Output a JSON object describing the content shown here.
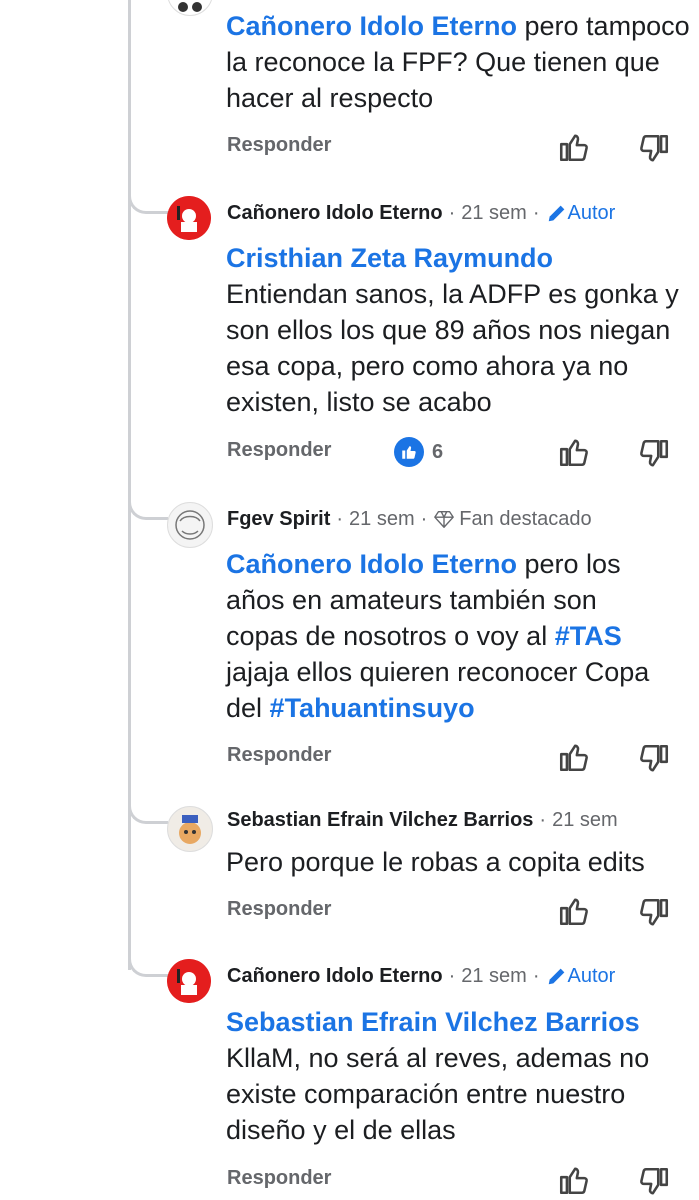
{
  "colors": {
    "accent": "#1b74e4",
    "muted": "#65676b",
    "line": "#ced0d4"
  },
  "comments": [
    {
      "mention": "Cañonero Idolo Eterno",
      "text": " pero tampoco la reconoce la FPF? Que tienen que hacer al respecto",
      "reply": "Responder"
    },
    {
      "author": "Cañonero Idolo Eterno",
      "time": "21 sem",
      "badge": "Autor",
      "mention": "Cristhian Zeta Raymundo",
      "text": "Entiendan sanos, la ADFP es gonka y son ellos los que 89 años nos niegan esa copa, pero como ahora ya no existen, listo se acabo",
      "reply": "Responder",
      "reactions": "6"
    },
    {
      "author": "Fgev Spirit",
      "time": "21 sem",
      "badge": "Fan destacado",
      "mention": "Cañonero Idolo Eterno",
      "text_a": " pero los años  en amateurs también son copas de nosotros o voy al ",
      "hashtag1": "#TAS",
      "text_b": " jajaja ellos quieren reconocer Copa del ",
      "hashtag2": "#Tahuantinsuyo",
      "reply": "Responder"
    },
    {
      "author": "Sebastian Efrain Vilchez Barrios",
      "time": "21 sem",
      "text": "Pero porque le robas a copita edits",
      "reply": "Responder"
    },
    {
      "author": "Cañonero Idolo Eterno",
      "time": "21 sem",
      "badge": "Autor",
      "mention": "Sebastian Efrain Vilchez Barrios",
      "text": "KllaM, no será al reves, ademas no existe comparación entre nuestro diseño y el de ellas",
      "reply": "Responder"
    }
  ],
  "icons": {
    "like": "thumbs-up-icon",
    "dislike": "thumbs-down-icon",
    "author": "pencil-icon",
    "fan": "diamond-icon"
  },
  "separator": "·"
}
